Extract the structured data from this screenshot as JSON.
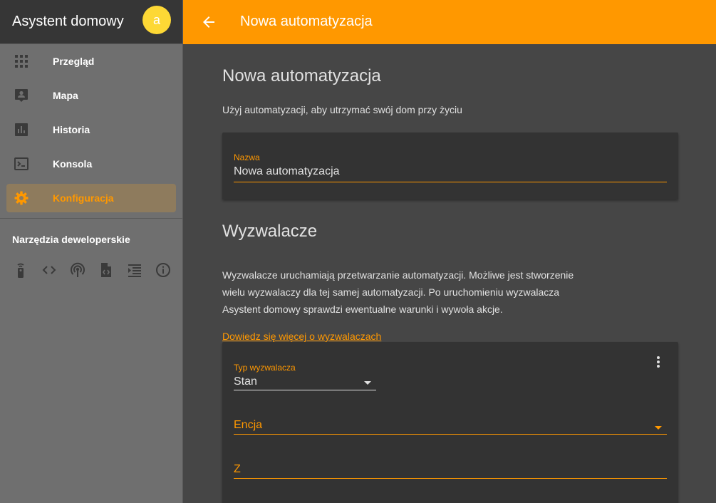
{
  "sidebar": {
    "title": "Asystent domowy",
    "avatar_letter": "a",
    "items": [
      {
        "label": "Przegląd",
        "icon": "grid-icon"
      },
      {
        "label": "Mapa",
        "icon": "map-person-icon"
      },
      {
        "label": "Historia",
        "icon": "chart-bar-icon"
      },
      {
        "label": "Konsola",
        "icon": "console-icon"
      },
      {
        "label": "Konfiguracja",
        "icon": "gear-icon",
        "active": true
      }
    ],
    "dev_tools_title": "Narzędzia deweloperskie",
    "dev_tools": [
      "remote-icon",
      "code-icon",
      "broadcast-icon",
      "file-code-icon",
      "template-icon",
      "info-icon"
    ]
  },
  "header": {
    "title": "Nowa automatyzacja"
  },
  "main": {
    "heading": "Nowa automatyzacja",
    "intro": "Użyj automatyzacji, aby utrzymać swój dom przy życiu",
    "name_field": {
      "label": "Nazwa",
      "value": "Nowa automatyzacja"
    },
    "triggers_heading": "Wyzwalacze",
    "triggers_desc": "Wyzwalacze uruchamiają przetwarzanie automatyzacji. Możliwe jest stworzenie wielu wyzwalaczy dla tej samej automatyzacji. Po uruchomieniu wyzwalacza Asystent domowy sprawdzi ewentualne warunki i wywoła akcje.",
    "triggers_link": "Dowiedz się więcej o wyzwalaczach",
    "trigger_card": {
      "type_label": "Typ wyzwalacza",
      "type_value": "Stan",
      "entity_label": "Encja",
      "from_label": "Z"
    }
  },
  "colors": {
    "accent": "#ff9800",
    "sidebar_bg": "#6f6f6f",
    "content_bg": "#464646",
    "card_bg": "#333333"
  }
}
